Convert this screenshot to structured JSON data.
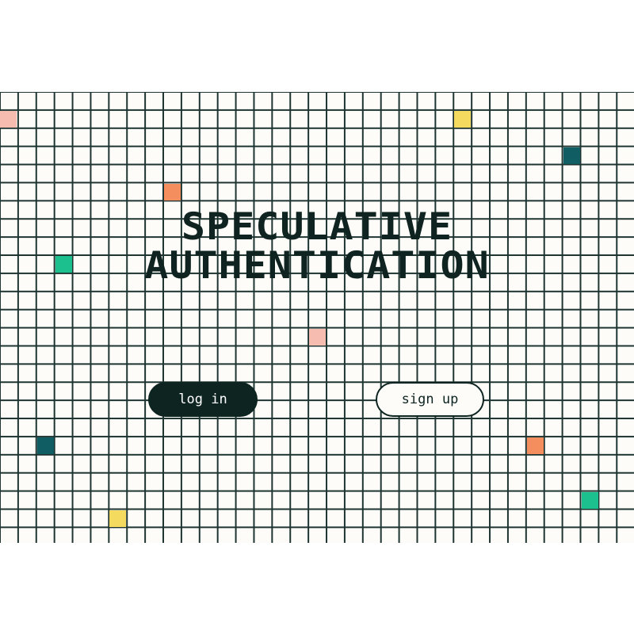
{
  "title": {
    "line1": "SPECULATIVE",
    "line2": "AUTHENTICATION"
  },
  "buttons": {
    "login_label": "log in",
    "signup_label": "sign up"
  },
  "colors": {
    "background": "#fdfcf9",
    "grid_line": "#1d3431",
    "text": "#0f2320",
    "button_dark": "#0d2421",
    "pink": "#f7bcb0",
    "yellow": "#f4da5e",
    "teal_dark": "#105d63",
    "orange": "#f48e5e",
    "green": "#1cc08f"
  },
  "decorative_cells": [
    {
      "color": "pink"
    },
    {
      "color": "yellow"
    },
    {
      "color": "teal_dark"
    },
    {
      "color": "orange"
    },
    {
      "color": "green"
    },
    {
      "color": "pink"
    },
    {
      "color": "teal_dark"
    },
    {
      "color": "orange"
    },
    {
      "color": "green"
    },
    {
      "color": "yellow"
    }
  ]
}
